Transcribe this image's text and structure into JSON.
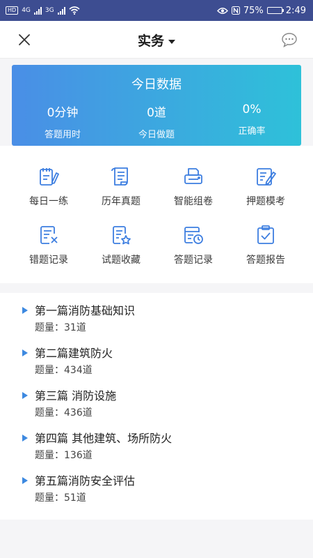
{
  "status_bar": {
    "hd": "HD",
    "net1": "4G",
    "net2": "3G",
    "battery": "75%",
    "battery_level": 0.75,
    "time": "2:49"
  },
  "nav": {
    "title": "实务"
  },
  "stats": {
    "title": "今日数据",
    "items": [
      {
        "value": "0分钟",
        "label": "答题用时"
      },
      {
        "value": "0道",
        "label": "今日做题"
      },
      {
        "value": "0%",
        "label": "正确率"
      }
    ]
  },
  "grid": {
    "accent": "#3d7ee0",
    "items": [
      {
        "label": "每日一练",
        "icon": "daily-practice-icon"
      },
      {
        "label": "历年真题",
        "icon": "past-papers-icon"
      },
      {
        "label": "智能组卷",
        "icon": "smart-paper-icon"
      },
      {
        "label": "押题模考",
        "icon": "mock-exam-icon"
      },
      {
        "label": "错题记录",
        "icon": "wrong-records-icon"
      },
      {
        "label": "试题收藏",
        "icon": "favorites-icon"
      },
      {
        "label": "答题记录",
        "icon": "answer-records-icon"
      },
      {
        "label": "答题报告",
        "icon": "answer-report-icon"
      }
    ]
  },
  "chapters": [
    {
      "title": "第一篇消防基础知识",
      "count": "题量：31道"
    },
    {
      "title": "第二篇建筑防火",
      "count": "题量：434道"
    },
    {
      "title": "第三篇 消防设施",
      "count": "题量：436道"
    },
    {
      "title": "第四篇 其他建筑、场所防火",
      "count": "题量：136道"
    },
    {
      "title": "第五篇消防安全评估",
      "count": "题量：51道"
    }
  ]
}
